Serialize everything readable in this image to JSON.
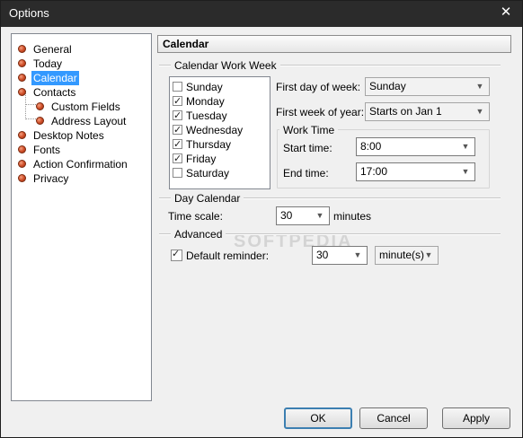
{
  "window": {
    "title": "Options",
    "close_glyph": "✕"
  },
  "tree": {
    "items": [
      {
        "label": "General"
      },
      {
        "label": "Today"
      },
      {
        "label": "Calendar"
      },
      {
        "label": "Contacts"
      },
      {
        "label": "Custom Fields"
      },
      {
        "label": "Address Layout"
      },
      {
        "label": "Desktop Notes"
      },
      {
        "label": "Fonts"
      },
      {
        "label": "Action Confirmation"
      },
      {
        "label": "Privacy"
      }
    ],
    "selected": "Calendar"
  },
  "panel": {
    "title": "Calendar"
  },
  "work_week": {
    "group_label": "Calendar Work Week",
    "days": [
      {
        "label": "Sunday",
        "checked": false
      },
      {
        "label": "Monday",
        "checked": true
      },
      {
        "label": "Tuesday",
        "checked": true
      },
      {
        "label": "Wednesday",
        "checked": true
      },
      {
        "label": "Thursday",
        "checked": true
      },
      {
        "label": "Friday",
        "checked": true
      },
      {
        "label": "Saturday",
        "checked": false
      }
    ],
    "first_day_label": "First day of week:",
    "first_day_value": "Sunday",
    "first_week_label": "First week of year:",
    "first_week_value": "Starts on Jan 1",
    "work_time_label": "Work Time",
    "start_label": "Start time:",
    "start_value": "8:00",
    "end_label": "End time:",
    "end_value": "17:00"
  },
  "day_calendar": {
    "group_label": "Day Calendar",
    "time_scale_label": "Time scale:",
    "time_scale_value": "30",
    "time_scale_unit": "minutes"
  },
  "advanced": {
    "group_label": "Advanced",
    "reminder_label": "Default reminder:",
    "reminder_checked": true,
    "reminder_value": "30",
    "reminder_unit": "minute(s)"
  },
  "buttons": {
    "ok": "OK",
    "cancel": "Cancel",
    "apply": "Apply"
  },
  "watermark": "SOFTPEDIA",
  "icons": {
    "dropdown": "chevron-down-icon",
    "tree_bullet": "orange-ball-icon"
  }
}
